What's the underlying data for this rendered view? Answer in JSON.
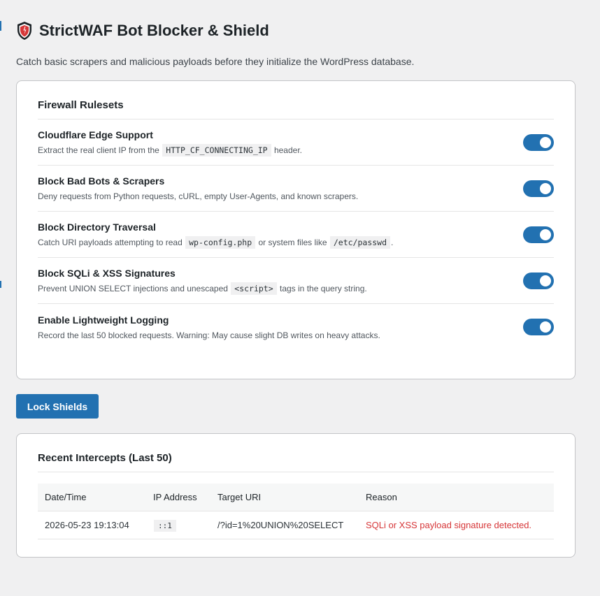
{
  "header": {
    "title": "StrictWAF Bot Blocker & Shield",
    "subtitle": "Catch basic scrapers and malicious payloads before they initialize the WordPress database.",
    "logo_icon": "shield-icon"
  },
  "colors": {
    "accent": "#2271b1",
    "danger": "#d63638",
    "background": "#f0f0f1"
  },
  "rulesets": {
    "title": "Firewall Rulesets",
    "rules": [
      {
        "name": "Cloudflare Edge Support",
        "desc_before": "Extract the real client IP from the",
        "code1": "HTTP_CF_CONNECTING_IP",
        "desc_middle": "header.",
        "enabled": true
      },
      {
        "name": "Block Bad Bots & Scrapers",
        "desc_before": "Deny requests from Python requests, cURL, empty User-Agents, and known scrapers.",
        "enabled": true
      },
      {
        "name": "Block Directory Traversal",
        "desc_before": "Catch URI payloads attempting to read",
        "code1": "wp-config.php",
        "desc_middle": "or system files like",
        "code2": "/etc/passwd",
        "desc_after": ".",
        "enabled": true
      },
      {
        "name": "Block SQLi & XSS Signatures",
        "desc_before": "Prevent UNION SELECT injections and unescaped",
        "code1": "<script>",
        "desc_middle": "tags in the query string.",
        "enabled": true
      },
      {
        "name": "Enable Lightweight Logging",
        "desc_before": "Record the last 50 blocked requests. Warning: May cause slight DB writes on heavy attacks.",
        "enabled": true
      }
    ]
  },
  "actions": {
    "lock_label": "Lock Shields"
  },
  "intercepts": {
    "title": "Recent Intercepts (Last 50)",
    "columns": [
      "Date/Time",
      "IP Address",
      "Target URI",
      "Reason"
    ],
    "rows": [
      {
        "datetime": "2026-05-23 19:13:04",
        "ip": "::1",
        "uri": "/?id=1%20UNION%20SELECT",
        "reason": "SQLi or XSS payload signature detected."
      }
    ]
  }
}
